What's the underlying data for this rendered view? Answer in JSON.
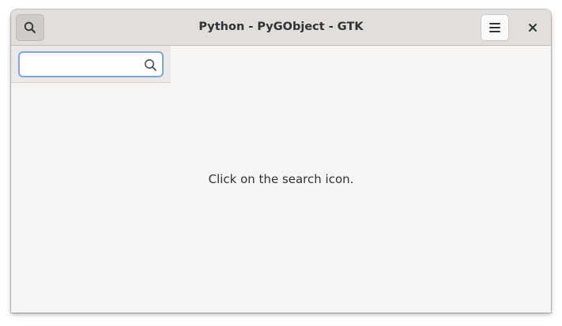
{
  "window": {
    "title": "Python - PyGObject - GTK"
  },
  "headerbar": {
    "search_toggle_icon": "search-icon",
    "menu_icon": "hamburger-menu-icon",
    "close_icon": "close-icon"
  },
  "searchbar": {
    "value": "",
    "placeholder": "",
    "icon": "search-icon"
  },
  "main": {
    "message": "Click on the search icon."
  },
  "colors": {
    "headerbar_bg": "#e1dedb",
    "window_bg": "#f6f5f4",
    "searchbar_bg": "#ebe9e7",
    "entry_focus_border": "#7fa6d9",
    "text": "#2e3436"
  }
}
